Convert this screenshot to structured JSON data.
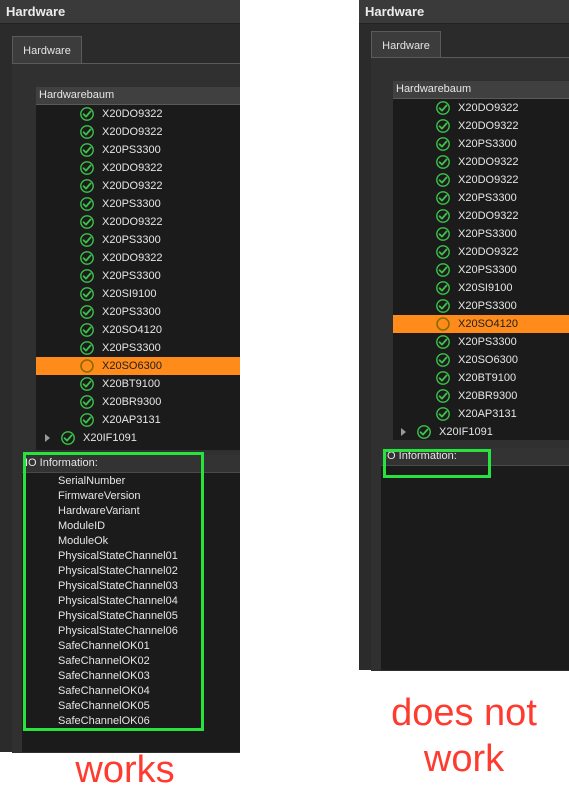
{
  "left": {
    "window_title": "Hardware",
    "tab_label": "Hardware",
    "tree_header": "Hardwarebaum",
    "modules": [
      {
        "label": "X20DO9322",
        "status": "ok"
      },
      {
        "label": "X20DO9322",
        "status": "ok"
      },
      {
        "label": "X20PS3300",
        "status": "ok"
      },
      {
        "label": "X20DO9322",
        "status": "ok"
      },
      {
        "label": "X20DO9322",
        "status": "ok"
      },
      {
        "label": "X20PS3300",
        "status": "ok"
      },
      {
        "label": "X20DO9322",
        "status": "ok"
      },
      {
        "label": "X20PS3300",
        "status": "ok"
      },
      {
        "label": "X20DO9322",
        "status": "ok"
      },
      {
        "label": "X20PS3300",
        "status": "ok"
      },
      {
        "label": "X20SI9100",
        "status": "ok"
      },
      {
        "label": "X20PS3300",
        "status": "ok"
      },
      {
        "label": "X20SO4120",
        "status": "ok"
      },
      {
        "label": "X20PS3300",
        "status": "ok"
      },
      {
        "label": "X20SO6300",
        "status": "pending",
        "selected": true
      },
      {
        "label": "X20BT9100",
        "status": "ok"
      },
      {
        "label": "X20BR9300",
        "status": "ok"
      },
      {
        "label": "X20AP3131",
        "status": "ok"
      }
    ],
    "parent_node": {
      "label": "X20IF1091",
      "status": "ok"
    },
    "io_header": "IO Information:",
    "io_items": [
      "SerialNumber",
      "FirmwareVersion",
      "HardwareVariant",
      "ModuleID",
      "ModuleOk",
      "PhysicalStateChannel01",
      "PhysicalStateChannel02",
      "PhysicalStateChannel03",
      "PhysicalStateChannel04",
      "PhysicalStateChannel05",
      "PhysicalStateChannel06",
      "SafeChannelOK01",
      "SafeChannelOK02",
      "SafeChannelOK03",
      "SafeChannelOK04",
      "SafeChannelOK05",
      "SafeChannelOK06"
    ],
    "caption": "works"
  },
  "right": {
    "window_title": "Hardware",
    "tab_label": "Hardware",
    "tree_header": "Hardwarebaum",
    "modules": [
      {
        "label": "X20DO9322",
        "status": "ok"
      },
      {
        "label": "X20DO9322",
        "status": "ok"
      },
      {
        "label": "X20PS3300",
        "status": "ok"
      },
      {
        "label": "X20DO9322",
        "status": "ok"
      },
      {
        "label": "X20DO9322",
        "status": "ok"
      },
      {
        "label": "X20PS3300",
        "status": "ok"
      },
      {
        "label": "X20DO9322",
        "status": "ok"
      },
      {
        "label": "X20PS3300",
        "status": "ok"
      },
      {
        "label": "X20DO9322",
        "status": "ok"
      },
      {
        "label": "X20PS3300",
        "status": "ok"
      },
      {
        "label": "X20SI9100",
        "status": "ok"
      },
      {
        "label": "X20PS3300",
        "status": "ok"
      },
      {
        "label": "X20SO4120",
        "status": "pending",
        "selected": true
      },
      {
        "label": "X20PS3300",
        "status": "ok"
      },
      {
        "label": "X20SO6300",
        "status": "ok"
      },
      {
        "label": "X20BT9100",
        "status": "ok"
      },
      {
        "label": "X20BR9300",
        "status": "ok"
      },
      {
        "label": "X20AP3131",
        "status": "ok"
      }
    ],
    "parent_node": {
      "label": "X20IF1091",
      "status": "ok"
    },
    "io_header": "IO Information:",
    "io_items": [],
    "caption": "does not\nwork"
  },
  "colors": {
    "selection": "#ff8c1a",
    "ok_icon": "#3cc24a",
    "highlight": "#27e33d",
    "caption": "#ff3b30"
  },
  "icons": {
    "ok": "green-checkmark-circle-icon",
    "pending": "empty-circle-icon",
    "expander": "triangle-right-icon"
  }
}
